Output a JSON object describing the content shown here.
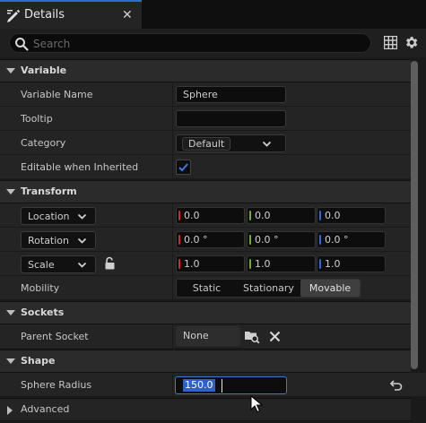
{
  "tab": {
    "title": "Details",
    "close_glyph": "✕",
    "icon": "pencil-icon"
  },
  "search": {
    "placeholder": "Search",
    "value": ""
  },
  "toolbar": {
    "grid_icon": "table-grid-icon",
    "settings_icon": "gear-icon"
  },
  "sections": {
    "variable": {
      "label": "Variable"
    },
    "transform": {
      "label": "Transform"
    },
    "sockets": {
      "label": "Sockets"
    },
    "shape": {
      "label": "Shape"
    },
    "advanced": {
      "label": "Advanced"
    }
  },
  "variable": {
    "name_label": "Variable Name",
    "name_value": "Sphere",
    "tooltip_label": "Tooltip",
    "tooltip_value": "",
    "category_label": "Category",
    "category_value": "Default",
    "editable_label": "Editable when Inherited",
    "editable_checked": true
  },
  "transform": {
    "location": {
      "label": "Location",
      "x": "0.0",
      "y": "0.0",
      "z": "0.0"
    },
    "rotation": {
      "label": "Rotation",
      "x": "0.0 °",
      "y": "0.0 °",
      "z": "0.0 °"
    },
    "scale": {
      "label": "Scale",
      "x": "1.0",
      "y": "1.0",
      "z": "1.0"
    },
    "mobility_label": "Mobility",
    "mobility_options": [
      "Static",
      "Stationary",
      "Movable"
    ],
    "mobility_selected": "Movable"
  },
  "sockets": {
    "parent_label": "Parent Socket",
    "parent_value": "None"
  },
  "shape": {
    "radius_label": "Sphere Radius",
    "radius_value": "150.0"
  },
  "colors": {
    "accent": "#2a6fd6",
    "x_axis": "#c62e2e",
    "y_axis": "#6fb025",
    "z_axis": "#2e6bd6",
    "check": "#3a7be0"
  }
}
